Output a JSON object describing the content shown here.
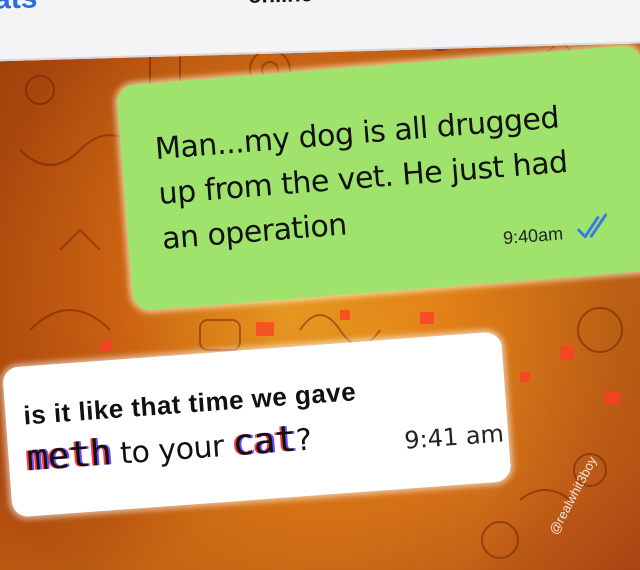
{
  "header": {
    "back_label": "ats",
    "status": "online"
  },
  "messages": [
    {
      "direction": "outgoing",
      "text": "Man...my dog is all drugged up from the vet. He just had an operation",
      "time": "9:40am",
      "receipt_icon": "double-check-icon"
    },
    {
      "direction": "incoming",
      "line1": "is it like that time we gave",
      "line2_parts": [
        "meth",
        " to your ",
        "cat",
        "?"
      ],
      "time": "9:41 am"
    }
  ],
  "watermark": "@realwhit3boy",
  "colors": {
    "outgoing_bubble": "#9fe26c",
    "incoming_bubble": "#ffffff",
    "background": "#c45a10",
    "accent": "#2a6fd6",
    "receipt": "#3a7be0"
  }
}
